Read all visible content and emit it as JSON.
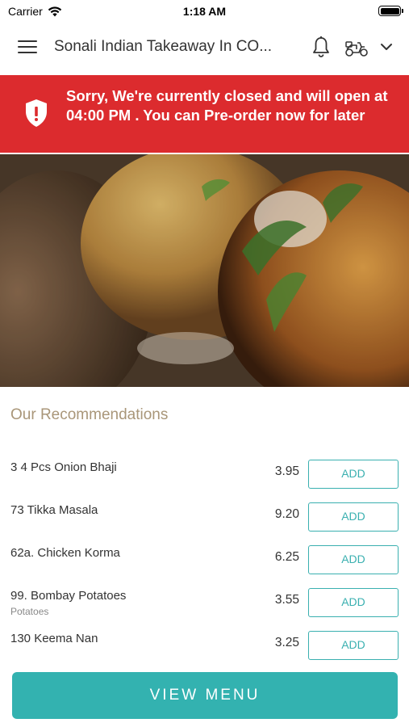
{
  "status_bar": {
    "carrier": "Carrier",
    "time": "1:18 AM"
  },
  "header": {
    "title": "Sonali Indian Takeaway In CO..."
  },
  "banner": {
    "message": "Sorry, We're currently closed and will open at 04:00 PM . You can Pre-order now for later",
    "color": "#dc2b2e"
  },
  "recommendations": {
    "title": "Our Recommendations",
    "add_label": "ADD",
    "items": [
      {
        "name": "3 4 Pcs Onion Bhaji",
        "description": "",
        "price": "3.95"
      },
      {
        "name": "73 Tikka Masala",
        "description": "",
        "price": "9.20"
      },
      {
        "name": "62a. Chicken Korma",
        "description": "",
        "price": "6.25"
      },
      {
        "name": "99. Bombay Potatoes",
        "description": "Potatoes",
        "price": "3.55"
      },
      {
        "name": "130 Keema Nan",
        "description": "",
        "price": "3.25"
      }
    ]
  },
  "footer": {
    "view_menu_label": "VIEW MENU",
    "accent_color": "#33b2b0"
  },
  "icons": [
    "wifi-icon",
    "battery-icon",
    "menu-icon",
    "bell-icon",
    "scooter-icon",
    "chevron-down-icon",
    "shield-alert-icon"
  ]
}
